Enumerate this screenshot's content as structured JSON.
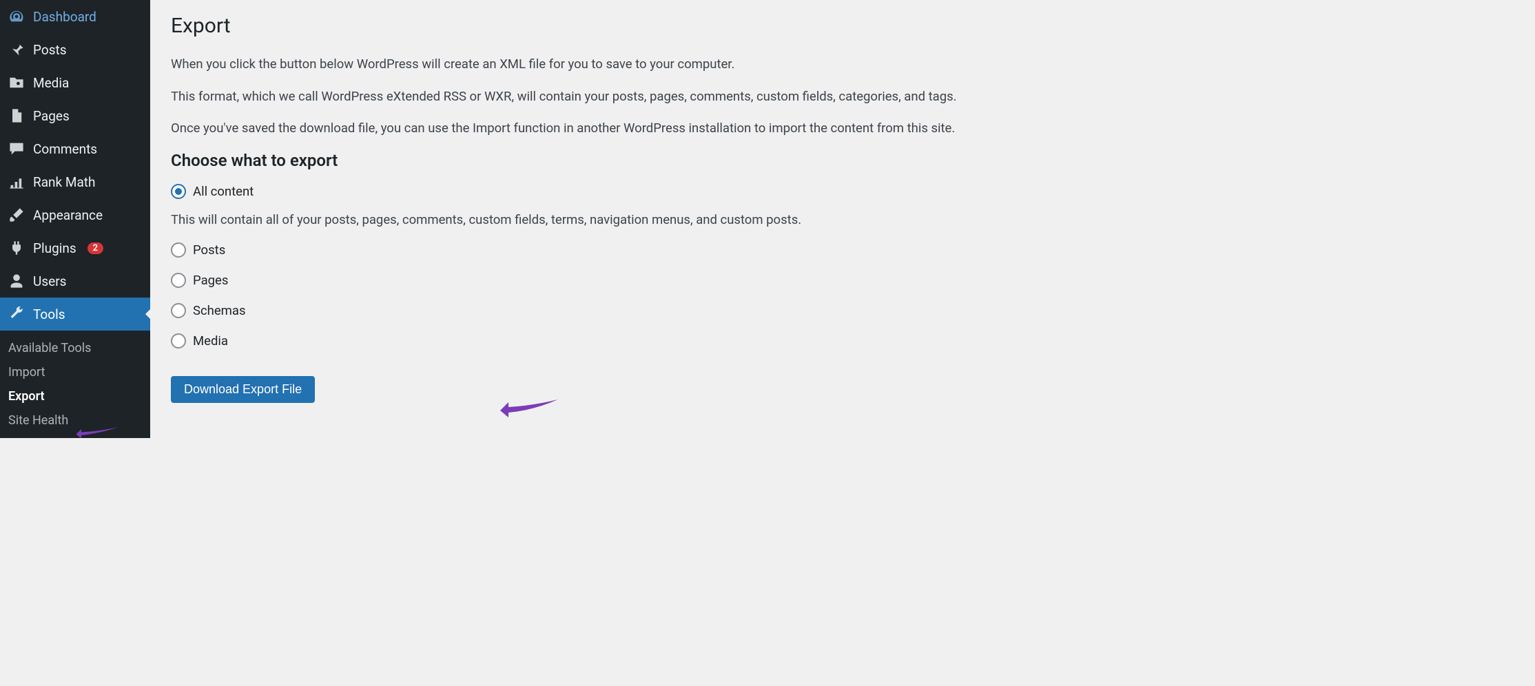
{
  "sidebar": {
    "items": [
      {
        "label": "Dashboard",
        "name": "dashboard"
      },
      {
        "label": "Posts",
        "name": "posts"
      },
      {
        "label": "Media",
        "name": "media"
      },
      {
        "label": "Pages",
        "name": "pages"
      },
      {
        "label": "Comments",
        "name": "comments"
      },
      {
        "label": "Rank Math",
        "name": "rank-math"
      },
      {
        "label": "Appearance",
        "name": "appearance"
      },
      {
        "label": "Plugins",
        "name": "plugins",
        "badge": "2"
      },
      {
        "label": "Users",
        "name": "users"
      },
      {
        "label": "Tools",
        "name": "tools",
        "active": true
      }
    ],
    "submenu": [
      {
        "label": "Available Tools"
      },
      {
        "label": "Import"
      },
      {
        "label": "Export",
        "current": true
      },
      {
        "label": "Site Health"
      }
    ]
  },
  "page": {
    "title": "Export",
    "intro1": "When you click the button below WordPress will create an XML file for you to save to your computer.",
    "intro2": "This format, which we call WordPress eXtended RSS or WXR, will contain your posts, pages, comments, custom fields, categories, and tags.",
    "intro3": "Once you've saved the download file, you can use the Import function in another WordPress installation to import the content from this site.",
    "choose_heading": "Choose what to export",
    "options": [
      {
        "label": "All content",
        "checked": true
      },
      {
        "label": "Posts"
      },
      {
        "label": "Pages"
      },
      {
        "label": "Schemas"
      },
      {
        "label": "Media"
      }
    ],
    "all_description": "This will contain all of your posts, pages, comments, custom fields, terms, navigation menus, and custom posts.",
    "download_button": "Download Export File"
  }
}
